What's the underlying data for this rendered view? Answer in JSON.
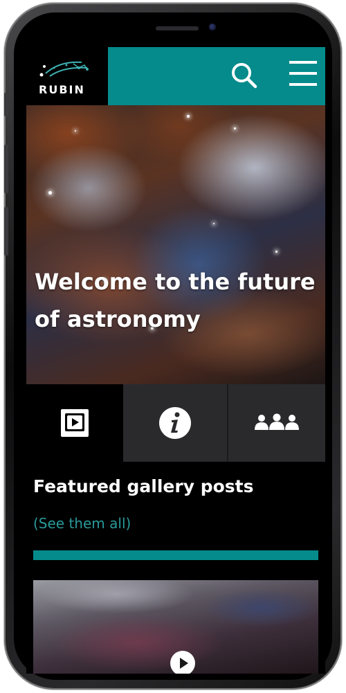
{
  "brand": {
    "name": "RUBIN"
  },
  "hero": {
    "title": "Welcome to the future of astronomy"
  },
  "tabs": [
    {
      "icon": "play-video-icon",
      "active": true
    },
    {
      "icon": "info-icon",
      "active": false
    },
    {
      "icon": "people-group-icon",
      "active": false
    }
  ],
  "gallery": {
    "title": "Featured gallery posts",
    "see_all": "(See them all)",
    "first_item_icon": "play-icon"
  },
  "colors": {
    "accent": "#058b8c",
    "link": "#2a9a9a",
    "background": "#000000",
    "tab_inactive": "#2a2a2d"
  }
}
